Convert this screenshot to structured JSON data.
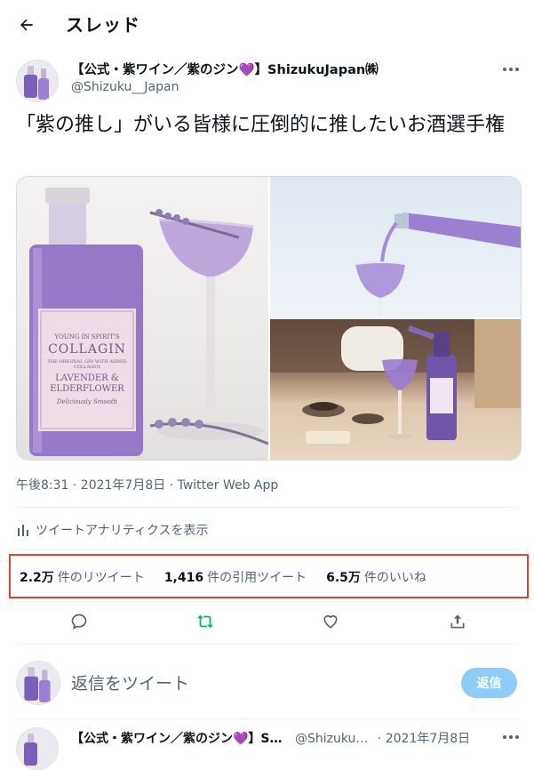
{
  "header": {
    "title": "スレッド",
    "back_icon": "back-arrow-icon"
  },
  "tweet": {
    "author_name": "【公式・紫ワイン／紫のジン💜】ShizukuJapan㈱",
    "author_handle": "@Shizuku__Japan",
    "text": "「紫の推し」がいる皆様に圧倒的に推したいお酒選手権",
    "media": {
      "bottle_label_top": "YOUNG IN SPIRIT'S",
      "bottle_brand": "COLLAGIN",
      "bottle_label_sub": "THE ORIGINAL GIN WITH ADDED COLLAGEN",
      "bottle_flavor": "LAVENDER & ELDERFLOWER",
      "bottle_tagline": "Deliciously Smooth"
    },
    "meta": "午後8:31 · 2021年7月8日 · Twitter Web App",
    "analytics_label": "ツイートアナリティクスを表示"
  },
  "stats": {
    "retweets_value": "2.2万",
    "retweets_label": "件のリツイート",
    "quotes_value": "1,416",
    "quotes_label": "件の引用ツイート",
    "likes_value": "6.5万",
    "likes_label": "件のいいね"
  },
  "reply": {
    "placeholder": "返信をツイート",
    "button": "返信"
  },
  "next_reply": {
    "author": "【公式・紫ワイン／紫のジン💜】S…",
    "handle": "@Shizuku…",
    "date": "· 2021年7月8日"
  },
  "colors": {
    "accent": "#1d9bf0",
    "retweet_green": "#00ba7c",
    "purple": "#8a6bc6",
    "highlight": "#e8412d"
  }
}
